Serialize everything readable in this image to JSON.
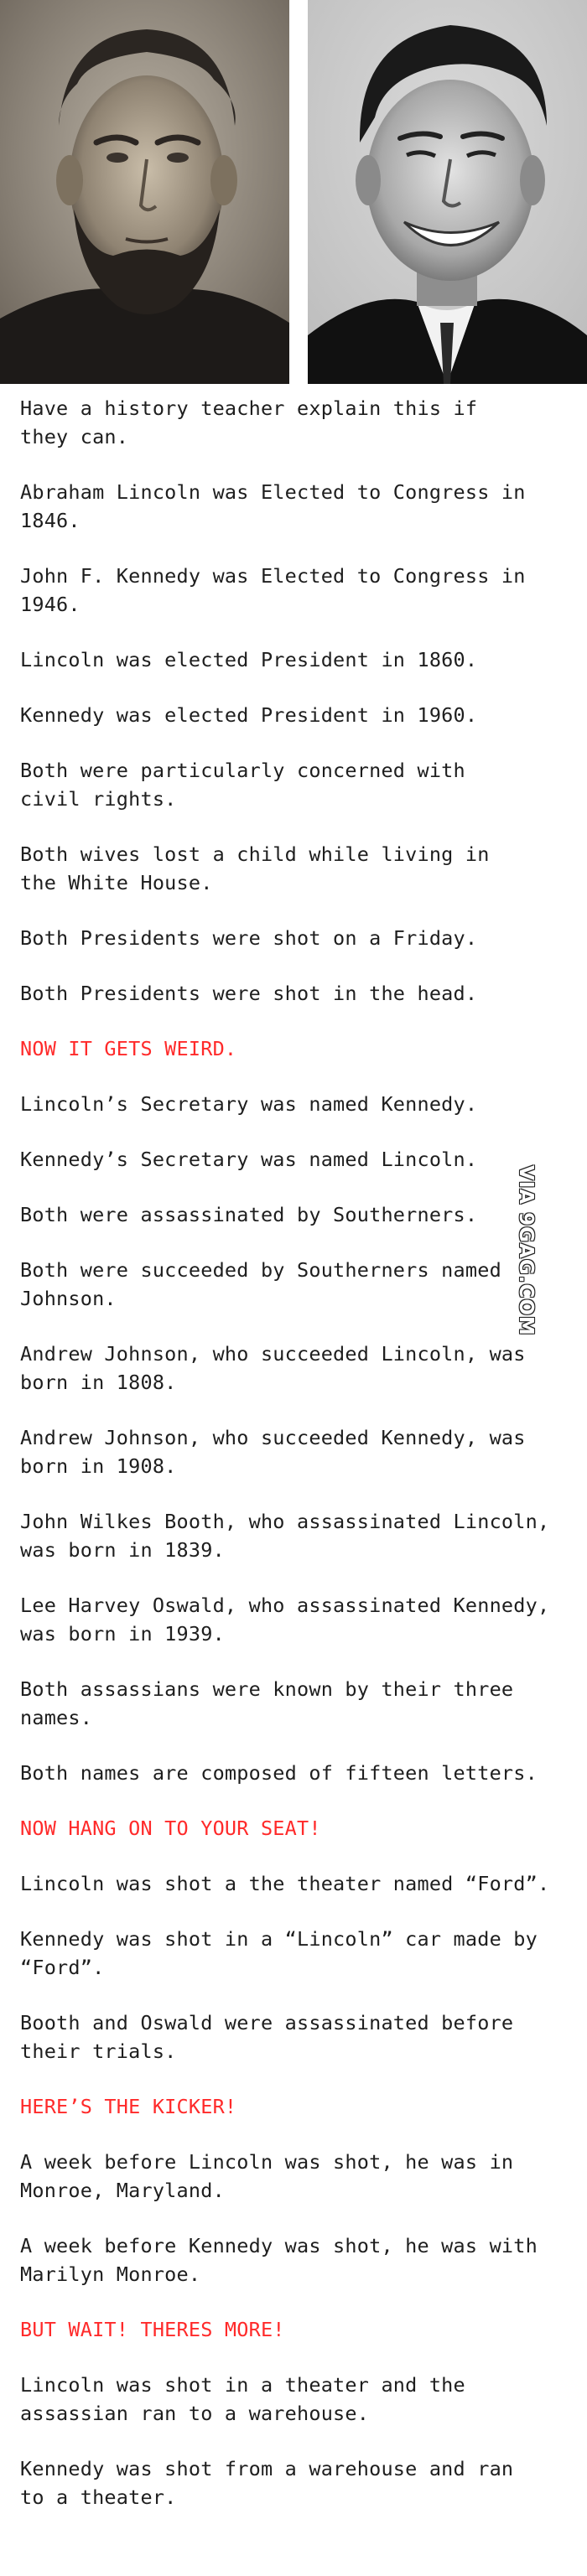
{
  "photos": [
    {
      "name": "lincoln-portrait"
    },
    {
      "name": "kennedy-portrait"
    }
  ],
  "lines": [
    {
      "text": "Have a history teacher explain this if\nthey can.",
      "color": "dark"
    },
    {
      "text": "Abraham Lincoln was Elected to Congress in\n1846.",
      "color": "dark"
    },
    {
      "text": "John F. Kennedy was Elected to Congress in\n1946.",
      "color": "dark"
    },
    {
      "text": "Lincoln was elected President in 1860.",
      "color": "dark"
    },
    {
      "text": "Kennedy was elected President in 1960.",
      "color": "dark"
    },
    {
      "text": "Both were particularly concerned with\ncivil rights.",
      "color": "dark"
    },
    {
      "text": "Both wives lost a child while living in\nthe White House.",
      "color": "dark"
    },
    {
      "text": "Both Presidents were shot on a Friday.",
      "color": "dark"
    },
    {
      "text": "Both Presidents were shot in the head.",
      "color": "dark"
    },
    {
      "text": "NOW IT GETS WEIRD.",
      "color": "red"
    },
    {
      "text": "Lincoln’s Secretary was named Kennedy.",
      "color": "dark"
    },
    {
      "text": "Kennedy’s Secretary was named Lincoln.",
      "color": "dark"
    },
    {
      "text": "Both were assassinated by Southerners.",
      "color": "dark"
    },
    {
      "text": "Both were succeeded by Southerners named\nJohnson.",
      "color": "dark"
    },
    {
      "text": "Andrew Johnson, who succeeded Lincoln, was\nborn in 1808.",
      "color": "dark"
    },
    {
      "text": "Andrew Johnson, who succeeded Kennedy, was\nborn in 1908.",
      "color": "dark"
    },
    {
      "text": "John Wilkes Booth, who assassinated Lincoln,\nwas born in 1839.",
      "color": "dark"
    },
    {
      "text": "Lee Harvey Oswald, who assassinated Kennedy,\nwas born in 1939.",
      "color": "dark"
    },
    {
      "text": "Both assassians were known by their three\nnames.",
      "color": "dark"
    },
    {
      "text": "Both names are composed of fifteen letters.",
      "color": "dark"
    },
    {
      "text": "NOW HANG ON TO YOUR SEAT!",
      "color": "red"
    },
    {
      "text": "Lincoln was shot a the theater named “Ford”.",
      "color": "dark"
    },
    {
      "text": "Kennedy was shot in a “Lincoln” car made by\n“Ford”.",
      "color": "dark"
    },
    {
      "text": "Booth and Oswald were assassinated before\ntheir trials.",
      "color": "dark"
    },
    {
      "text": "HERE’S THE KICKER!",
      "color": "red"
    },
    {
      "text": "A week before Lincoln was shot, he was in\nMonroe, Maryland.",
      "color": "dark"
    },
    {
      "text": "A week before Kennedy was shot, he was with\nMarilyn Monroe.",
      "color": "dark"
    },
    {
      "text": "BUT WAIT! THERES MORE!",
      "color": "red"
    },
    {
      "text": "Lincoln was shot in a theater and the\nassassian ran to a warehouse.",
      "color": "dark"
    },
    {
      "text": "Kennedy was shot from a warehouse and ran\nto a theater.",
      "color": "dark"
    }
  ],
  "watermark": "VIA 9GAG.COM",
  "colors": {
    "text": "#1e1e1e",
    "accent_red": "#ff2a2a",
    "background": "#ffffff"
  }
}
